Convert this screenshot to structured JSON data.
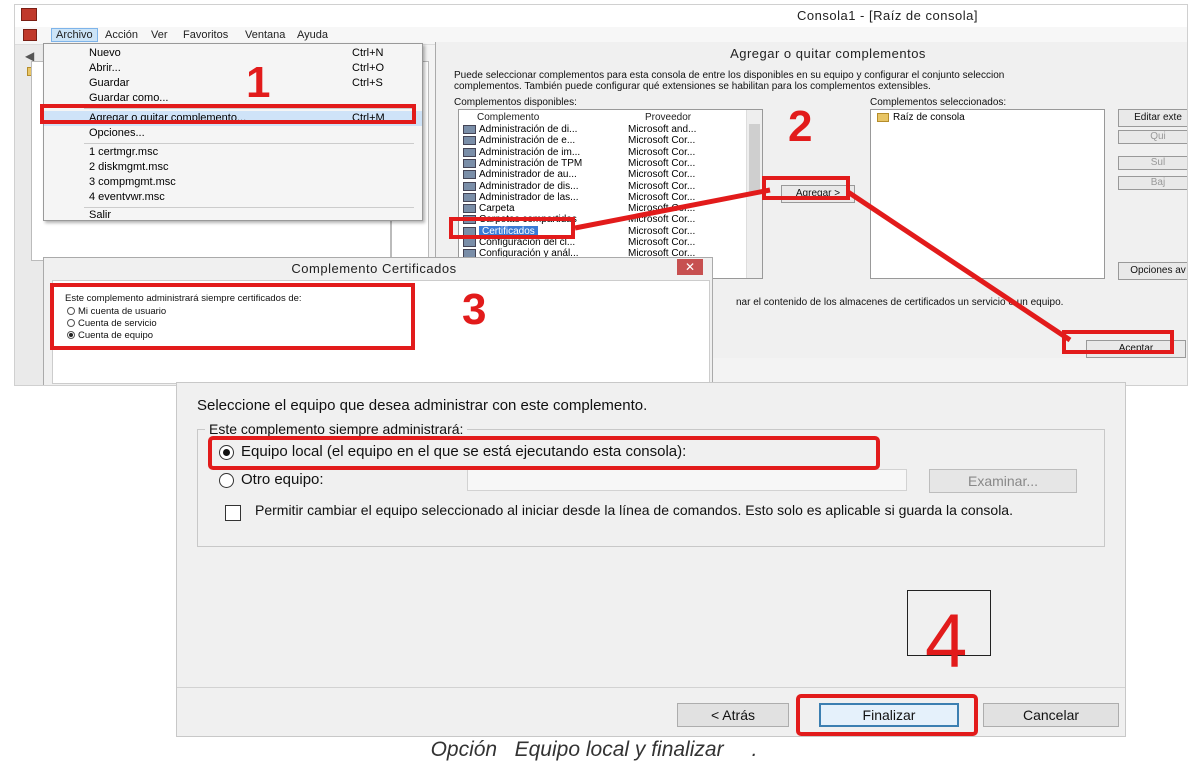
{
  "window": {
    "title": "Consola1 - [Raíz de consola]"
  },
  "menubar": {
    "items": [
      "Archivo",
      "Acción",
      "Ver",
      "Favoritos",
      "Ventana",
      "Ayuda"
    ]
  },
  "file_menu": {
    "items": [
      {
        "label": "Nuevo",
        "shortcut": "Ctrl+N"
      },
      {
        "label": "Abrir...",
        "shortcut": "Ctrl+O"
      },
      {
        "label": "Guardar",
        "shortcut": "Ctrl+S"
      },
      {
        "label": "Guardar como...",
        "shortcut": ""
      },
      {
        "label": "Agregar o quitar complemento...",
        "shortcut": "Ctrl+M"
      },
      {
        "label": "Opciones...",
        "shortcut": ""
      },
      {
        "label": "1 certmgr.msc",
        "shortcut": ""
      },
      {
        "label": "2 diskmgmt.msc",
        "shortcut": ""
      },
      {
        "label": "3 compmgmt.msc",
        "shortcut": ""
      },
      {
        "label": "4 eventvwr.msc",
        "shortcut": ""
      },
      {
        "label": "Salir",
        "shortcut": ""
      }
    ]
  },
  "snapin_dialog": {
    "title": "Agregar o quitar complementos",
    "description": "Puede seleccionar complementos para esta consola de entre los disponibles en su equipo y configurar el conjunto seleccion\ncomplementos. También puede configurar qué extensiones se habilitan para los complementos extensibles.",
    "available_label": "Complementos disponibles:",
    "selected_label": "Complementos seleccionados:",
    "columns": {
      "name": "Complemento",
      "provider": "Proveedor"
    },
    "available": [
      {
        "name": "Administración de di...",
        "provider": "Microsoft and..."
      },
      {
        "name": "Administración de e...",
        "provider": "Microsoft Cor..."
      },
      {
        "name": "Administración de im...",
        "provider": "Microsoft Cor..."
      },
      {
        "name": "Administración de TPM",
        "provider": "Microsoft Cor..."
      },
      {
        "name": "Administrador de au...",
        "provider": "Microsoft Cor..."
      },
      {
        "name": "Administrador de dis...",
        "provider": "Microsoft Cor..."
      },
      {
        "name": "Administrador de las...",
        "provider": "Microsoft Cor..."
      },
      {
        "name": "Carpeta",
        "provider": "Microsoft Cor..."
      },
      {
        "name": "Carpetas compartidas",
        "provider": "Microsoft Cor..."
      },
      {
        "name": "Certificados",
        "provider": "Microsoft Cor..."
      },
      {
        "name": "Configuración del cl...",
        "provider": "Microsoft Cor..."
      },
      {
        "name": "Configuración y anál...",
        "provider": "Microsoft Cor..."
      }
    ],
    "selected": [
      "Raíz de consola"
    ],
    "add_button": "Agregar >",
    "edit_button": "Editar exte",
    "up_button": "Qui",
    "up2_button": "Sul",
    "down_button": "Baj",
    "advanced_button": "Opciones av",
    "description_text": "nar el contenido de los almacenes de certificados un servicio o un equipo.",
    "ok_button": "Aceptar"
  },
  "cert_dialog": {
    "title": "Complemento Certificados",
    "close_glyph": "✕",
    "prompt": "Este complemento administrará siempre certificados de:",
    "options": [
      "Mi cuenta de usuario",
      "Cuenta de servicio",
      "Cuenta de equipo"
    ],
    "selected_option": 2
  },
  "computer_dialog": {
    "prompt": "Seleccione el equipo que desea administrar con este complemento.",
    "group_label": "Este complemento siempre administrará:",
    "option_local": "Equipo local (el equipo en el que se está ejecutando esta consola):",
    "option_other": "Otro equipo:",
    "other_value": "",
    "browse_button": "Examinar...",
    "checkbox_label": "Permitir cambiar el equipo seleccionado al iniciar desde la línea de comandos. Esto solo es aplicable si guarda la consola.",
    "checkbox_checked": false,
    "back_button": "< Atrás",
    "finish_button": "Finalizar",
    "cancel_button": "Cancelar"
  },
  "annotations": {
    "step1": "1",
    "step2": "2",
    "step3": "3",
    "step4": "4",
    "color": "#e21b1b"
  },
  "caption": {
    "main": "Opción   Equipo local y finalizar",
    "dot": "."
  }
}
